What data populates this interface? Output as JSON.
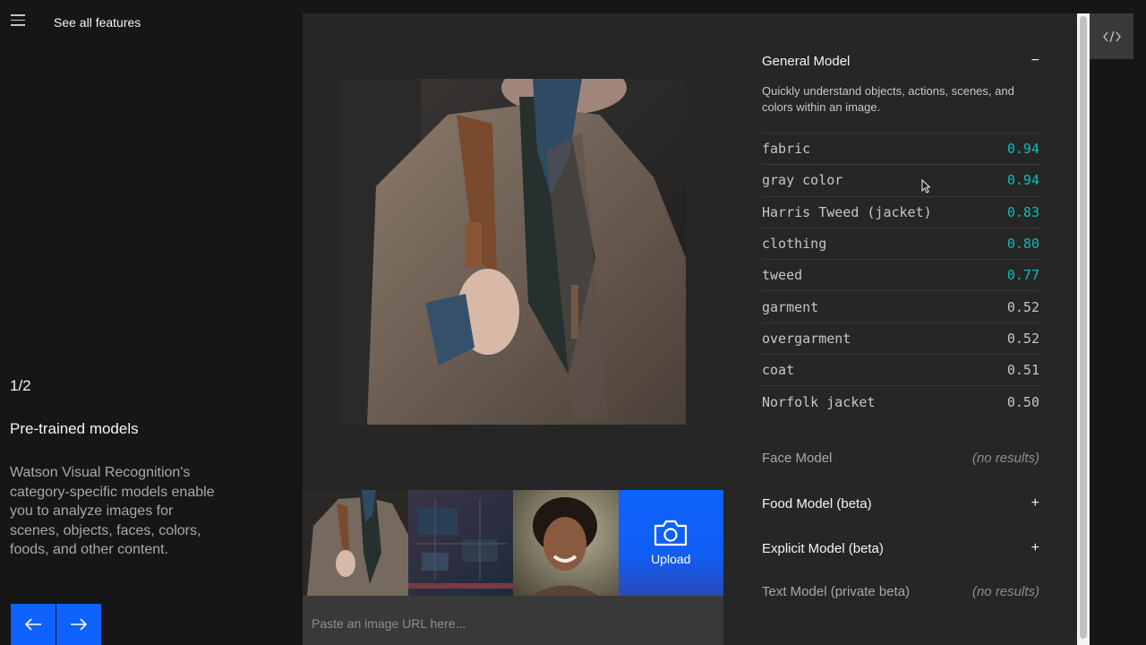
{
  "header": {
    "menu_icon": "hamburger-menu-icon",
    "see_all_label": "See all features"
  },
  "slide": {
    "counter": "1/2",
    "title": "Pre-trained models",
    "description": "Watson Visual Recognition's category-specific models enable you to analyze images for scenes, objects, faces, colors, foods, and other content.",
    "prev_icon": "arrow-left-icon",
    "next_icon": "arrow-right-icon"
  },
  "image_panel": {
    "thumbnails": [
      {
        "name": "tweed-jacket-thumbnail"
      },
      {
        "name": "circuit-board-thumbnail"
      },
      {
        "name": "smiling-woman-thumbnail"
      }
    ],
    "upload_label": "Upload",
    "upload_icon": "camera-icon",
    "url_placeholder": "Paste an image URL here..."
  },
  "models": {
    "general": {
      "name": "General Model",
      "toggle": "−",
      "description": "Quickly understand objects, actions, scenes, and colors within an image.",
      "results": [
        {
          "label": "fabric",
          "score": "0.94",
          "high": true
        },
        {
          "label": "gray color",
          "score": "0.94",
          "high": true
        },
        {
          "label": "Harris Tweed (jacket)",
          "score": "0.83",
          "high": true
        },
        {
          "label": "clothing",
          "score": "0.80",
          "high": true
        },
        {
          "label": "tweed",
          "score": "0.77",
          "high": true
        },
        {
          "label": "garment",
          "score": "0.52",
          "high": false
        },
        {
          "label": "overgarment",
          "score": "0.52",
          "high": false
        },
        {
          "label": "coat",
          "score": "0.51",
          "high": false
        },
        {
          "label": "Norfolk jacket",
          "score": "0.50",
          "high": false
        }
      ]
    },
    "face": {
      "name": "Face Model",
      "status": "(no results)"
    },
    "food": {
      "name": "Food Model (beta)",
      "toggle": "+"
    },
    "explicit": {
      "name": "Explicit Model (beta)",
      "toggle": "+"
    },
    "text": {
      "name": "Text Model (private beta)",
      "status": "(no results)"
    }
  },
  "code_button_icon": "code-icon",
  "colors": {
    "accent_blue": "#0f62fe",
    "high_score_teal": "#08bdba",
    "background": "#161616",
    "panel": "#262626"
  }
}
